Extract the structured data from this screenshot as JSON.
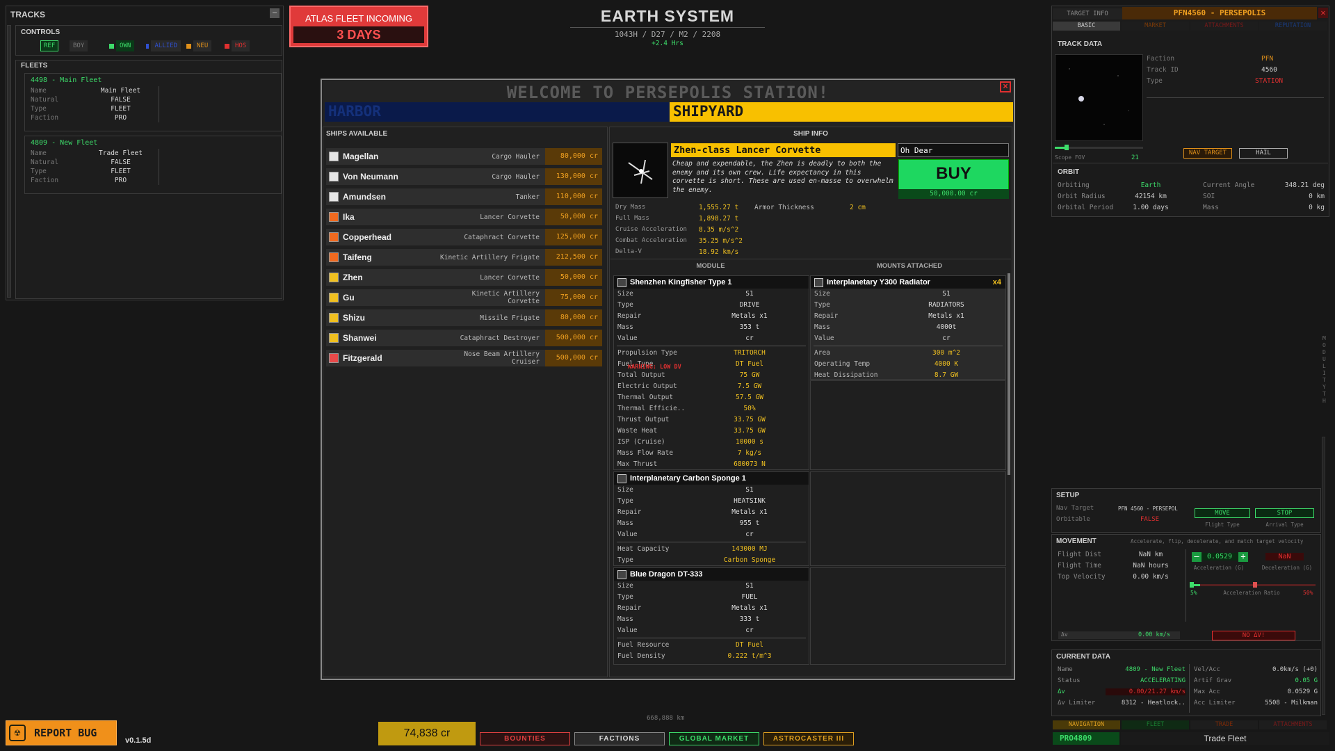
{
  "tracks": {
    "title": "TRACKS",
    "controls_title": "CONTROLS",
    "controls": [
      {
        "label": "REF",
        "color": "#3ddc6a"
      },
      {
        "label": "BOY",
        "color": "#777777"
      },
      {
        "label": "OWN",
        "color": "#3ddc6a"
      },
      {
        "label": "ALLIED",
        "color": "#3050d0"
      },
      {
        "label": "NEU",
        "color": "#e0901a"
      },
      {
        "label": "HOS",
        "color": "#e03030"
      }
    ],
    "fleets_title": "FLEETS",
    "fleets": [
      {
        "title": "4498 - Main Fleet",
        "name": "Main Fleet",
        "natural": "FALSE",
        "type": "FLEET",
        "faction": "PRO"
      },
      {
        "title": "4809 - New Fleet",
        "name": "Trade Fleet",
        "natural": "FALSE",
        "type": "FLEET",
        "faction": "PRO"
      }
    ],
    "labels": {
      "name": "Name",
      "natural": "Natural",
      "type": "Type",
      "faction": "Faction"
    }
  },
  "alert": {
    "title": "ATLAS FLEET INCOMING",
    "value": "3 DAYS"
  },
  "system": {
    "title": "EARTH SYSTEM",
    "date": "1043H / D27 / M2 / 2208",
    "rate": "+2.4 Hrs"
  },
  "modal": {
    "title": "WELCOME TO PERSEPOLIS STATION!",
    "tabs": [
      "HARBOR",
      "SHIPYARD"
    ],
    "ships_header": "SHIPS AVAILABLE",
    "ships": [
      {
        "name": "Magellan",
        "cls": "Cargo Hauler",
        "price": "80,000 cr",
        "color": "#e6e6e6"
      },
      {
        "name": "Von Neumann",
        "cls": "Cargo Hauler",
        "price": "130,000 cr",
        "color": "#e6e6e6"
      },
      {
        "name": "Amundsen",
        "cls": "Tanker",
        "price": "110,000 cr",
        "color": "#e6e6e6"
      },
      {
        "name": "Ika",
        "cls": "Lancer Corvette",
        "price": "50,000 cr",
        "color": "#f06a20"
      },
      {
        "name": "Copperhead",
        "cls": "Cataphract Corvette",
        "price": "125,000 cr",
        "color": "#f06a20"
      },
      {
        "name": "Taifeng",
        "cls": "Kinetic Artillery Frigate",
        "price": "212,500 cr",
        "color": "#f06a20"
      },
      {
        "name": "Zhen",
        "cls": "Lancer Corvette",
        "price": "50,000 cr",
        "color": "#f0c020"
      },
      {
        "name": "Gu",
        "cls": "Kinetic Artillery Corvette",
        "price": "75,000 cr",
        "color": "#f0c020"
      },
      {
        "name": "Shizu",
        "cls": "Missile Frigate",
        "price": "80,000 cr",
        "color": "#f0c020"
      },
      {
        "name": "Shanwei",
        "cls": "Cataphract Destroyer",
        "price": "500,000 cr",
        "color": "#f0c020"
      },
      {
        "name": "Fitzgerald",
        "cls": "Nose Beam Artillery Cruiser",
        "price": "500,000 cr",
        "color": "#e84a4a"
      }
    ],
    "shipinfo_header": "SHIP INFO",
    "ship_title": "Zhen-class Lancer Corvette",
    "ship_desc": "Cheap and expendable, the Zhen is deadly to both the enemy and its own crew. Life expectancy in this corvette is short. These are used en-masse to overwhelm the enemy.",
    "name_input": "Oh Dear",
    "buy_label": "BUY",
    "buy_price": "50,000.00 cr",
    "stats": [
      {
        "k": "Dry Mass",
        "v": "1,555.27 t"
      },
      {
        "k": "Full Mass",
        "v": "1,898.27 t"
      },
      {
        "k": "Cruise Acceleration",
        "v": "8.35 m/s^2"
      },
      {
        "k": "Combat Acceleration",
        "v": "35.25 m/s^2"
      },
      {
        "k": "Delta-V",
        "v": "18.92 km/s"
      }
    ],
    "armor_label": "Armor Thickness",
    "armor_value": "2 cm",
    "module_header": "MODULE",
    "mounts_header": "MOUNTS ATTACHED",
    "modules": {
      "drive": {
        "title": "Shenzhen Kingfisher Type 1",
        "basic": [
          [
            "Size",
            "S1"
          ],
          [
            "Type",
            "DRIVE"
          ],
          [
            "Repair",
            "Metals x1"
          ],
          [
            "Mass",
            "353 t"
          ],
          [
            "Value",
            "cr"
          ]
        ],
        "extra": [
          [
            "Propulsion Type",
            "TRITORCH"
          ],
          [
            "Fuel Type",
            "DT Fuel"
          ],
          [
            "Total Output",
            "75 GW"
          ],
          [
            "Electric Output",
            "7.5 GW"
          ],
          [
            "Thermal Output",
            "57.5 GW"
          ],
          [
            "Thermal Efficie..",
            "50%"
          ],
          [
            "Thrust Output",
            "33.75 GW"
          ],
          [
            "Waste Heat",
            "33.75 GW"
          ],
          [
            "ISP (Cruise)",
            "10000 s"
          ],
          [
            "Mass Flow Rate",
            "7 kg/s"
          ],
          [
            "Max Thrust",
            "680073 N"
          ]
        ],
        "warning": "WARNING: LOW DV"
      },
      "radiator": {
        "title": "Interplanetary Y300 Radiator",
        "count": "x4",
        "basic": [
          [
            "Size",
            "S1"
          ],
          [
            "Type",
            "RADIATORS"
          ],
          [
            "Repair",
            "Metals x1"
          ],
          [
            "Mass",
            "4000t"
          ],
          [
            "Value",
            "cr"
          ]
        ],
        "extra": [
          [
            "Area",
            "300 m^2"
          ],
          [
            "Operating Temp",
            "4000 K"
          ],
          [
            "Heat Dissipation",
            "8.7 GW"
          ]
        ]
      },
      "heatsink": {
        "title": "Interplanetary Carbon Sponge 1",
        "basic": [
          [
            "Size",
            "S1"
          ],
          [
            "Type",
            "HEATSINK"
          ],
          [
            "Repair",
            "Metals x1"
          ],
          [
            "Mass",
            "955 t"
          ],
          [
            "Value",
            "cr"
          ]
        ],
        "extra": [
          [
            "Heat Capacity",
            "143000 MJ"
          ],
          [
            "Type",
            "Carbon Sponge"
          ]
        ]
      },
      "fuel": {
        "title": "Blue Dragon DT-333",
        "basic": [
          [
            "Size",
            "S1"
          ],
          [
            "Type",
            "FUEL"
          ],
          [
            "Repair",
            "Metals x1"
          ],
          [
            "Mass",
            "333 t"
          ],
          [
            "Value",
            "cr"
          ]
        ],
        "extra": [
          [
            "Fuel Resource",
            "DT Fuel"
          ],
          [
            "Fuel Density",
            "0.222 t/m^3"
          ]
        ]
      }
    }
  },
  "target": {
    "label": "TARGET INFO",
    "value": "PFN4560 - PERSEPOLIS",
    "tabs": [
      "BASIC",
      "MARKET",
      "ATTACHMENTS",
      "REPUTATION"
    ],
    "track_title": "TRACK DATA",
    "faction_k": "Faction",
    "faction_v": "PFN",
    "trackid_k": "Track ID",
    "trackid_v": "4560",
    "type_k": "Type",
    "type_v": "STATION",
    "scope_k": "Scope FOV",
    "scope_v": "21",
    "nav_btn": "NAV TARGET",
    "hail_btn": "HAIL",
    "orbit_title": "ORBIT",
    "orbit": [
      [
        "Orbiting",
        "Earth",
        "Current Angle",
        "348.21 deg"
      ],
      [
        "Orbit Radius",
        "42154 km",
        "SOI",
        "0 km"
      ],
      [
        "Orbital Period",
        "1.00 days",
        "Mass",
        "0 kg"
      ]
    ]
  },
  "setup": {
    "title": "SETUP",
    "nav_k": "Nav Target",
    "nav_v": "PFN 4560 - PERSEPOL",
    "orbitable_k": "Orbitable",
    "orbitable_v": "FALSE",
    "move": "MOVE",
    "stop": "STOP",
    "flight_type": "Flight Type",
    "arrival_type": "Arrival Type"
  },
  "movement": {
    "title": "MOVEMENT",
    "desc": "Accelerate, flip, decelerate, and match target velocity",
    "rows": [
      [
        "Flight Dist",
        "NaN km"
      ],
      [
        "Flight Time",
        "NaN hours"
      ],
      [
        "Top Velocity",
        "0.00 km/s"
      ]
    ],
    "accel_value": "0.0529",
    "decel_value": "NaN",
    "accel_label": "Acceleration (G)",
    "decel_label": "Deceleration (G)",
    "ratio_left": "5%",
    "ratio_label": "Acceleration Ratio",
    "ratio_right": "50%",
    "dv_label": "Δv",
    "dv_value": "0.00 km/s",
    "nodv": "NO ΔV!"
  },
  "current": {
    "title": "CURRENT DATA",
    "left": [
      [
        "Name",
        "4809 - New Fleet"
      ],
      [
        "Status",
        "ACCELERATING"
      ],
      [
        "Δv",
        "0.00/21.27 km/s"
      ],
      [
        "Δv Limiter",
        "8312 - Heatlock.."
      ]
    ],
    "right": [
      [
        "Vel/Acc",
        "0.0km/s (+0)"
      ],
      [
        "Artif Grav",
        "0.05 G"
      ],
      [
        "Max Acc",
        "0.0529 G"
      ],
      [
        "Acc Limiter",
        "5508 - Milkman"
      ]
    ]
  },
  "bottom_right": {
    "tabs": [
      "NAVIGATION",
      "FLEET",
      "TRADE",
      "ATTACHMENTS"
    ],
    "id": "PRO4809",
    "name": "Trade Fleet"
  },
  "side_vertical": "MODULITY TH",
  "footer": {
    "report": "REPORT BUG",
    "version": "v0.1.5d",
    "credits": "74,838 cr",
    "distance": "668,888 km",
    "buttons": [
      "BOUNTIES",
      "FACTIONS",
      "GLOBAL MARKET",
      "ASTROCASTER III"
    ]
  }
}
